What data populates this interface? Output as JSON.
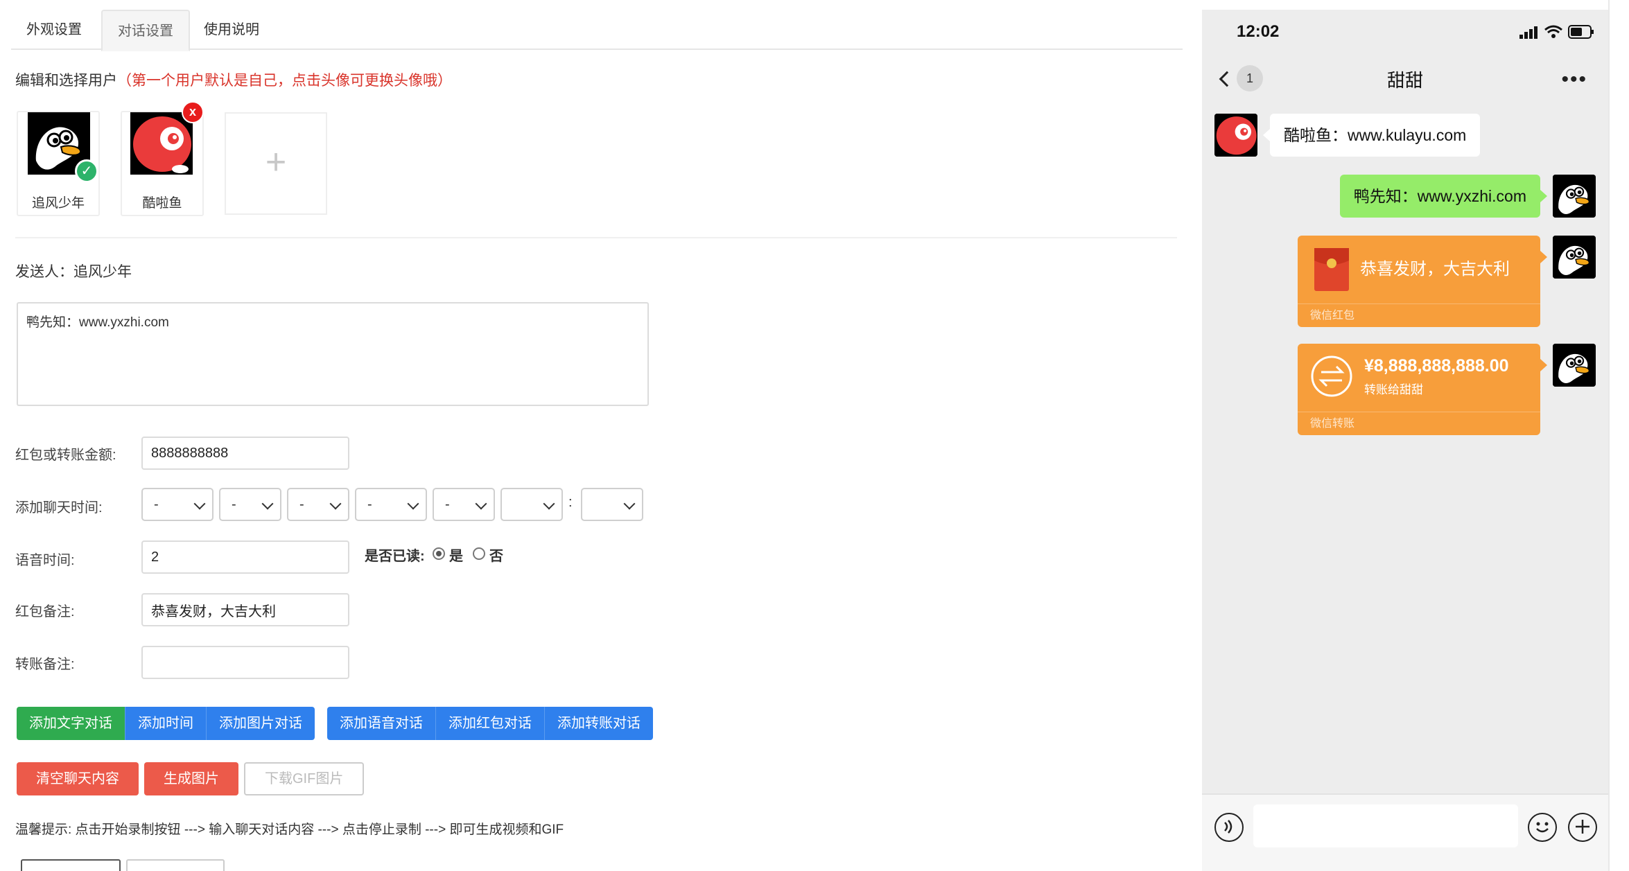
{
  "tabs": [
    "外观设置",
    "对话设置",
    "使用说明"
  ],
  "users_section": {
    "title": "编辑和选择用户",
    "hint": "（第一个用户默认是自己，点击头像可更换头像哦）",
    "users": [
      {
        "name": "追风少年",
        "selected": true
      },
      {
        "name": "酷啦鱼",
        "deletable": true
      }
    ],
    "add_label": "+",
    "delete_label": "x",
    "check_label": "✓"
  },
  "sender": {
    "label": "发送人：",
    "name": "追风少年"
  },
  "message_text": "鸭先知：www.yxzhi.com",
  "form": {
    "amount_label": "红包或转账金额:",
    "amount_value": "8888888888",
    "time_label": "添加聊天时间:",
    "time_selects": [
      "-",
      "-",
      "-",
      "-",
      "-",
      "",
      ""
    ],
    "time_colon": ":",
    "voice_label": "语音时间:",
    "voice_value": "2",
    "read_label": "是否已读:",
    "read_yes": "是",
    "read_no": "否",
    "read_selected": "是",
    "redpacket_note_label": "红包备注:",
    "redpacket_note_value": "恭喜发财，大吉大利",
    "transfer_note_label": "转账备注:",
    "transfer_note_value": ""
  },
  "buttons_row1_a": [
    "添加文字对话",
    "添加时间",
    "添加图片对话"
  ],
  "buttons_row1_b": [
    "添加语音对话",
    "添加红包对话",
    "添加转账对话"
  ],
  "buttons_row2": [
    "清空聊天内容",
    "生成图片",
    "下载GIF图片"
  ],
  "tip": "温馨提示: 点击开始录制按钮 ---> 输入聊天对话内容 ---> 点击停止录制 ---> 即可生成视频和GIF",
  "phone": {
    "status_time": "12:02",
    "unread_count": "1",
    "chat_title": "甜甜",
    "messages": [
      {
        "side": "left",
        "text": "酷啦鱼：www.kulayu.com"
      },
      {
        "side": "right",
        "text": "鸭先知：www.yxzhi.com"
      }
    ],
    "redpacket": {
      "text": "恭喜发财，大吉大利",
      "footer": "微信红包"
    },
    "transfer": {
      "amount": "¥8,888,888,888.00",
      "to": "转账给甜甜",
      "footer": "微信转账"
    }
  },
  "colors": {
    "red_hint": "#d9342b",
    "green_button": "#2fab4f",
    "blue_button": "#2f80ed",
    "red_button": "#ec5a4a",
    "wechat_green": "#95ec69",
    "wechat_orange": "#f79e3b"
  }
}
